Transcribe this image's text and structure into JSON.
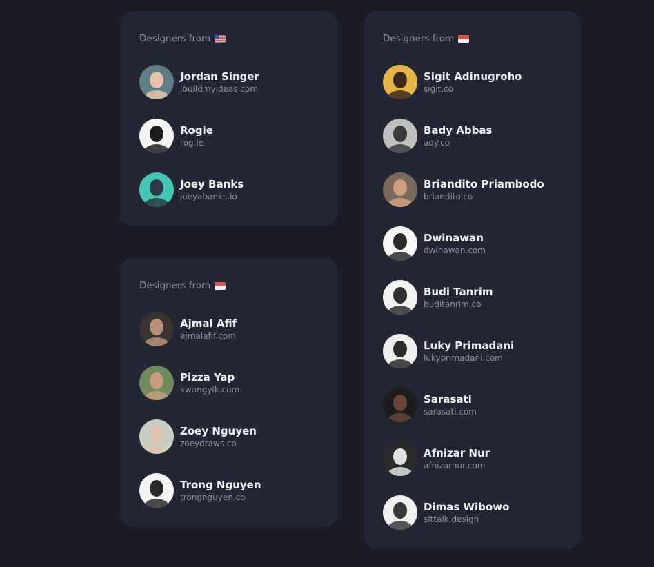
{
  "cards": [
    {
      "title": "Designers from",
      "flag": "us-flag",
      "people": [
        {
          "name": "Jordan Singer",
          "site": "ibuildmyideas.com",
          "avatar_bg": "#5e7d86",
          "avatar_fg": "#e7c3a6"
        },
        {
          "name": "Rogie",
          "site": "rog.ie",
          "avatar_bg": "#f4f4f4",
          "avatar_fg": "#1d1d1d"
        },
        {
          "name": "Joey Banks",
          "site": "joeyabanks.io",
          "avatar_bg": "#47c7b5",
          "avatar_fg": "#2c3a44"
        }
      ]
    },
    {
      "title": "Designers from",
      "flag": "id-flag",
      "people": [
        {
          "name": "Ajmal Afif",
          "site": "ajmalafif.com",
          "avatar_bg": "#3a3330",
          "avatar_fg": "#b8907a"
        },
        {
          "name": "Pizza Yap",
          "site": "kwangyik.com",
          "avatar_bg": "#6f8b5e",
          "avatar_fg": "#c99b80"
        },
        {
          "name": "Zoey Nguyen",
          "site": "zoeydraws.co",
          "avatar_bg": "#c9cfc4",
          "avatar_fg": "#e3c6b0"
        },
        {
          "name": "Trong Nguyen",
          "site": "trongnguyen.co",
          "avatar_bg": "#f4f4f4",
          "avatar_fg": "#2b2b2b"
        }
      ]
    },
    {
      "title": "Designers from",
      "flag": "id-flag",
      "people": [
        {
          "name": "Sigit Adinugroho",
          "site": "sigit.co",
          "avatar_bg": "#e8b54a",
          "avatar_fg": "#3a2a1e"
        },
        {
          "name": "Bady Abbas",
          "site": "ady.co",
          "avatar_bg": "#bfbfbf",
          "avatar_fg": "#3b3b3b"
        },
        {
          "name": "Briandito Priambodo",
          "site": "briandito.co",
          "avatar_bg": "#7a6a5c",
          "avatar_fg": "#d0a07e"
        },
        {
          "name": "Dwinawan",
          "site": "dwinawan.com",
          "avatar_bg": "#f5f5f5",
          "avatar_fg": "#2a2a2a"
        },
        {
          "name": "Budi Tanrim",
          "site": "buditanrim.co",
          "avatar_bg": "#f2f2f2",
          "avatar_fg": "#2f2f2f"
        },
        {
          "name": "Luky Primadani",
          "site": "lukyprimadani.com",
          "avatar_bg": "#efefef",
          "avatar_fg": "#2a2a2a"
        },
        {
          "name": "Sarasati",
          "site": "sarasati.com",
          "avatar_bg": "#1e1c1e",
          "avatar_fg": "#6a4535"
        },
        {
          "name": "Afnizar Nur",
          "site": "afnizarnur.com",
          "avatar_bg": "#2a2a2a",
          "avatar_fg": "#e0e0e0"
        },
        {
          "name": "Dimas Wibowo",
          "site": "sittalk.design",
          "avatar_bg": "#f0f0f0",
          "avatar_fg": "#3a3a3a"
        }
      ]
    }
  ]
}
